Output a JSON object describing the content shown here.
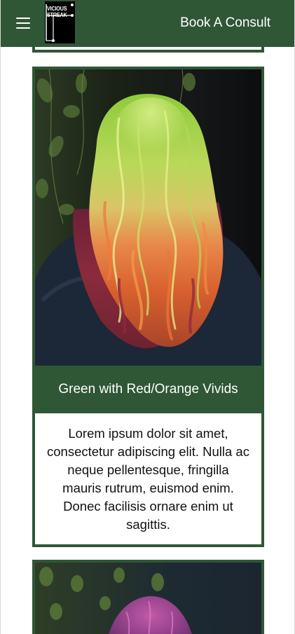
{
  "header": {
    "menu_icon": "hamburger-menu-icon",
    "logo_lines": [
      "VICIOUS",
      "STREAK"
    ],
    "book_label": "Book A Consult"
  },
  "gallery": [
    {
      "image": "green-red-orange-vivid-hair-photo",
      "title": "Green with Red/Orange Vivids",
      "description": "Lorem ipsum dolor sit amet, consectetur adipiscing elit. Nulla ac neque pellentesque, fringilla mauris rutrum, euismod enim. Donec facilisis ornare enim ut sagittis."
    },
    {
      "image": "purple-vivid-hair-photo"
    }
  ],
  "colors": {
    "brand_green": "#2f5736",
    "header_text": "#ffffff",
    "body_text": "#111111"
  }
}
